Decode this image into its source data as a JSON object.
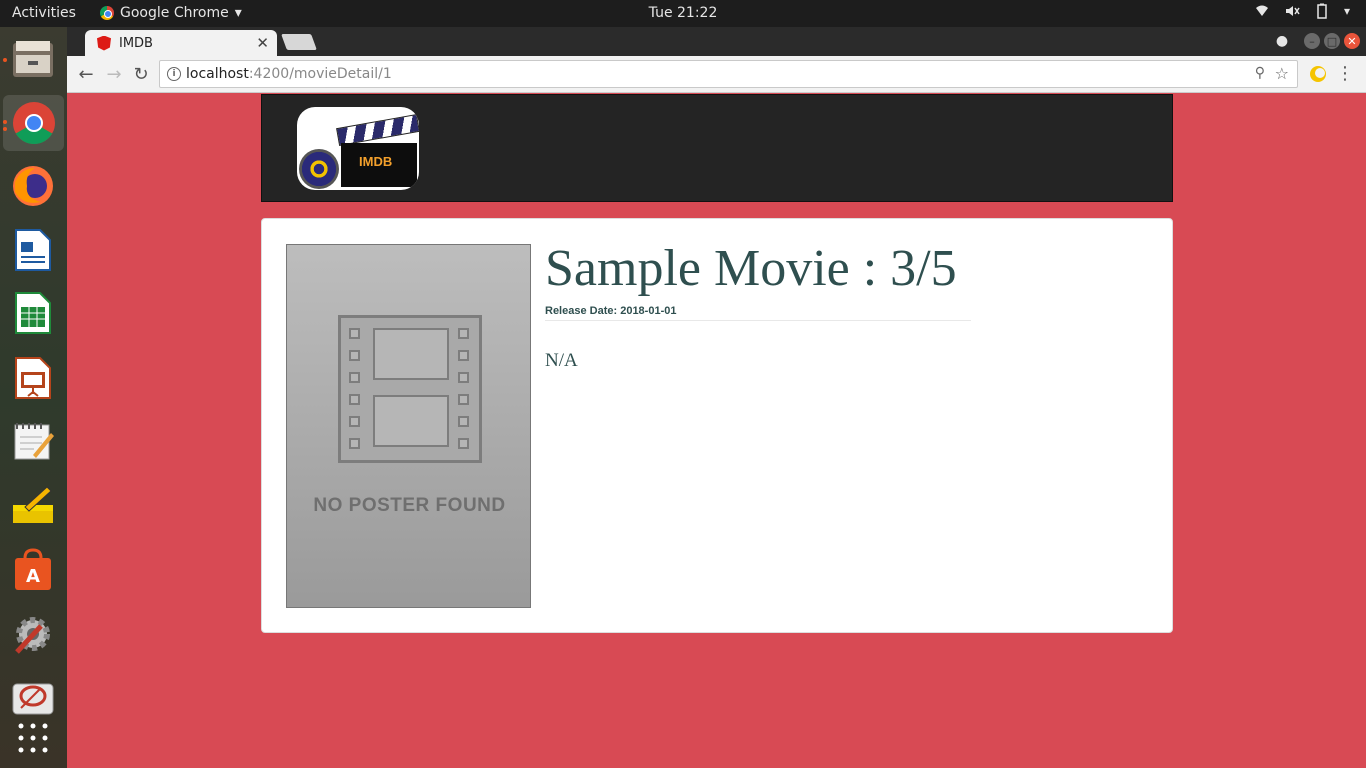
{
  "topbar": {
    "activities": "Activities",
    "app_name": "Google Chrome",
    "clock": "Tue 21:22"
  },
  "dock": {
    "items": [
      "files-icon",
      "chrome-icon",
      "firefox-icon",
      "writer-icon",
      "calc-icon",
      "impress-icon",
      "text-editor-icon",
      "notes-icon",
      "software-center-icon",
      "settings-icon",
      "disc-icon",
      "show-apps-icon"
    ]
  },
  "browser": {
    "tab_title": "IMDB",
    "url_host": "localhost",
    "url_path": ":4200/movieDetail/1"
  },
  "site": {
    "logo_text": "IMDB"
  },
  "movie": {
    "title": "Sample Movie : 3/5",
    "release": "Release Date: 2018-01-01",
    "plot": "N/A",
    "poster_text": "NO POSTER FOUND"
  },
  "colors": {
    "page_background": "#d84a54",
    "header_background": "#242424",
    "title_color": "#2f4f4f"
  }
}
